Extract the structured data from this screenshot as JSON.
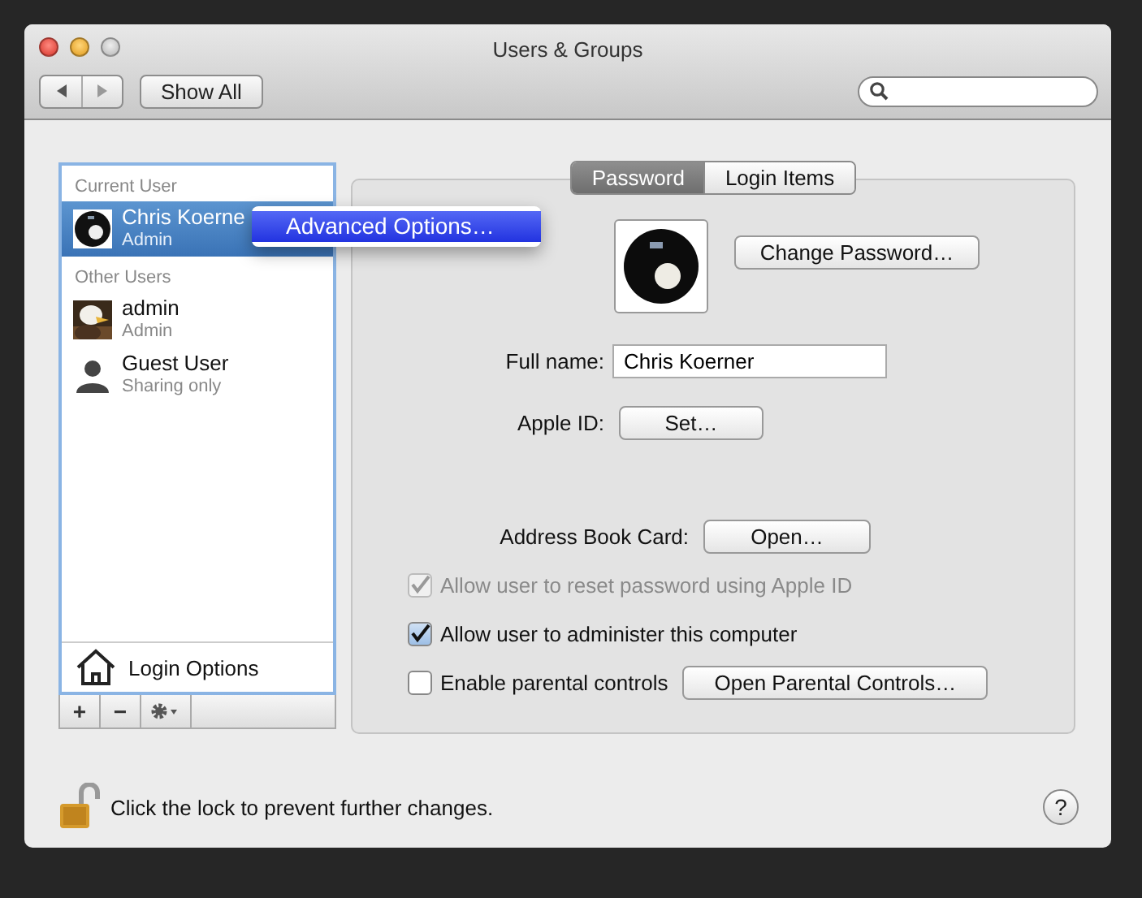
{
  "window": {
    "title": "Users & Groups"
  },
  "toolbar": {
    "show_all": "Show All"
  },
  "users": {
    "sections": [
      {
        "heading": "Current User",
        "items": [
          {
            "name": "Chris Koerne",
            "role": "Admin",
            "kind": "ball",
            "selected": true
          }
        ]
      },
      {
        "heading": "Other Users",
        "items": [
          {
            "name": "admin",
            "role": "Admin",
            "kind": "picture",
            "selected": false
          },
          {
            "name": "Guest User",
            "role": "Sharing only",
            "kind": "silhouette",
            "selected": false
          }
        ]
      }
    ],
    "login_options": "Login Options",
    "buttons": [
      "+",
      "−"
    ]
  },
  "context_menu": {
    "items": [
      {
        "label": "Advanced Options…",
        "selected": true
      }
    ]
  },
  "tabs": [
    {
      "label": "Password",
      "selected": true
    },
    {
      "label": "Login Items",
      "selected": false
    }
  ],
  "form": {
    "change_password": "Change Password…",
    "full_name": {
      "label": "Full name:",
      "value": "Chris Koerner"
    },
    "apple_id": {
      "label": "Apple ID:",
      "button": "Set…"
    },
    "address_book": {
      "label": "Address Book Card:",
      "button": "Open…"
    },
    "checkboxes": [
      {
        "label": "Allow user to reset password using Apple ID",
        "checked": true,
        "disabled": true
      },
      {
        "label": "Allow user to administer this computer",
        "checked": true,
        "disabled": false
      },
      {
        "label": "Enable parental controls",
        "checked": false,
        "disabled": false
      }
    ],
    "parental_button": "Open Parental Controls…"
  },
  "footer": {
    "lock_text": "Click the lock to prevent further changes.",
    "help": "?"
  }
}
